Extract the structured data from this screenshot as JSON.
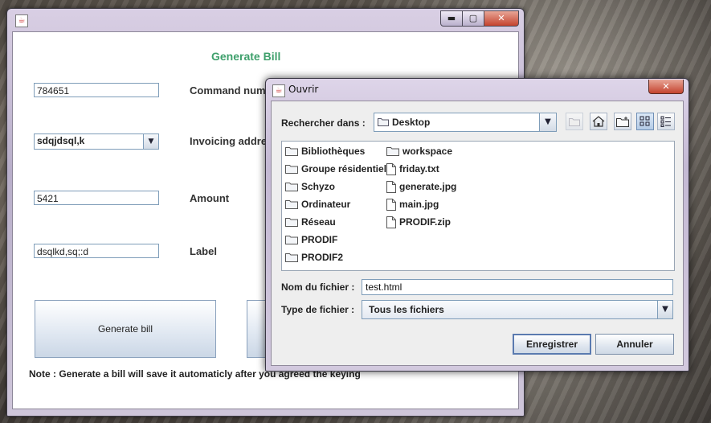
{
  "main_window": {
    "title": "",
    "controls": {
      "minimize": "▬",
      "maximize": "▢",
      "close": "✕"
    },
    "heading": "Generate Bill",
    "fields": {
      "command_number": {
        "value": "784651",
        "label": "Command num"
      },
      "invoicing_address": {
        "value": "sdqjdsql,k",
        "label": "Invoicing addre"
      },
      "amount": {
        "value": "5421",
        "label": "Amount"
      },
      "label": {
        "value": "dsqlkd,sq;:d",
        "label": "Label"
      }
    },
    "generate_button": "Generate bill",
    "note": "Note : Generate a bill will save it automaticly after you agreed the keying"
  },
  "dialog": {
    "title": "Ouvrir",
    "close": "✕",
    "look_in_label": "Rechercher dans :",
    "look_in_value": "Desktop",
    "items_col1": [
      "Bibliothèques",
      "Groupe résidentiel",
      "Schyzo",
      "Ordinateur",
      "Réseau",
      "PRODIF",
      "PRODIF2"
    ],
    "items_col2": [
      {
        "name": "workspace",
        "kind": "folder"
      },
      {
        "name": "friday.txt",
        "kind": "file"
      },
      {
        "name": "generate.jpg",
        "kind": "file"
      },
      {
        "name": "main.jpg",
        "kind": "file"
      },
      {
        "name": "PRODIF.zip",
        "kind": "file"
      }
    ],
    "filename_label": "Nom du fichier :",
    "filename_value": "test.html",
    "filetype_label": "Type de fichier :",
    "filetype_value": "Tous les fichiers",
    "save_button": "Enregistrer",
    "cancel_button": "Annuler"
  }
}
